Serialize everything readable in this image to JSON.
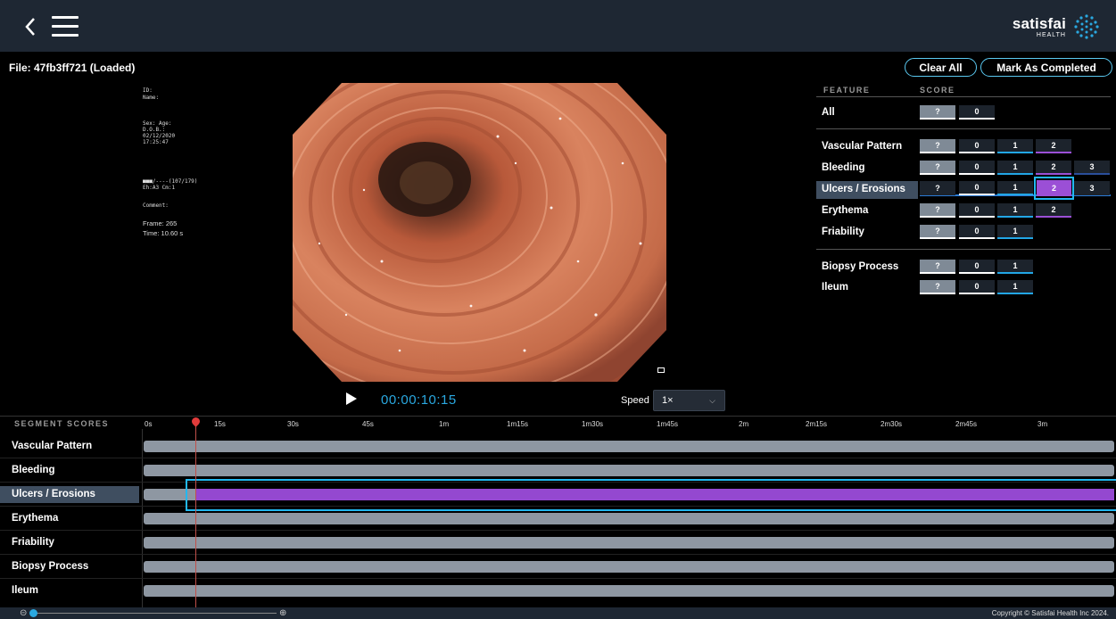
{
  "header": {
    "logo_main": "satisfai",
    "logo_sub": "HEALTH"
  },
  "file": {
    "label": "File: 47fb3ff721 (Loaded)"
  },
  "actions": {
    "clear_all": "Clear All",
    "mark_completed": "Mark As Completed"
  },
  "patient_info": {
    "id": "ID:",
    "name": "Name:",
    "sex_age": "Sex:  Age:",
    "dob": "D.O.B.:",
    "date": "02/12/2020",
    "time": "17:25:47",
    "signal": "■■■/----(107/179)",
    "eh": "Eh:A3 Cm:1",
    "comment": "Comment:",
    "frame": "Frame: 265",
    "time_s": "Time: 10.60 s"
  },
  "player": {
    "timecode": "00:00:10:15",
    "speed_label": "Speed",
    "speed_value": "1×"
  },
  "feature_panel": {
    "header_feature": "FEATURE",
    "header_score": "SCORE",
    "rows": [
      {
        "name": "All",
        "scores": [
          "?",
          "0"
        ]
      },
      {
        "name": "Vascular Pattern",
        "scores": [
          "?",
          "0",
          "1",
          "2"
        ]
      },
      {
        "name": "Bleeding",
        "scores": [
          "?",
          "0",
          "1",
          "2",
          "3"
        ]
      },
      {
        "name": "Ulcers / Erosions",
        "scores": [
          "?",
          "0",
          "1",
          "2",
          "3"
        ],
        "selected": "2"
      },
      {
        "name": "Erythema",
        "scores": [
          "?",
          "0",
          "1",
          "2"
        ]
      },
      {
        "name": "Friability",
        "scores": [
          "?",
          "0",
          "1"
        ]
      },
      {
        "name": "Biopsy Process",
        "scores": [
          "?",
          "0",
          "1"
        ]
      },
      {
        "name": "Ileum",
        "scores": [
          "?",
          "0",
          "1"
        ]
      }
    ]
  },
  "segments": {
    "title": "SEGMENT SCORES",
    "ticks": [
      "0s",
      "15s",
      "30s",
      "45s",
      "1m",
      "1m15s",
      "1m30s",
      "1m45s",
      "2m",
      "2m15s",
      "2m30s",
      "2m45s",
      "3m"
    ],
    "rows": [
      "Vascular Pattern",
      "Bleeding",
      "Ulcers / Erosions",
      "Erythema",
      "Friability",
      "Biopsy Process",
      "Ileum"
    ]
  },
  "footer": {
    "copyright": "Copyright © Satisfai Health Inc 2024."
  },
  "colors": {
    "accent": "#22a6e6",
    "selected": "#9b4fd6",
    "topbar": "#1e2733",
    "playhead": "#e23b3b"
  }
}
